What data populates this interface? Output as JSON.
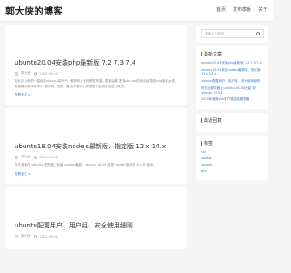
{
  "header": {
    "title": "郭大侠的博客",
    "nav": [
      "首页",
      "发布模板",
      "关于"
    ]
  },
  "posts": [
    {
      "title": "ubuntu20.04安装php最新版 7.2 7.3 7.4",
      "author": "郭大侠",
      "date": "2020-03-02",
      "excerpt": "因长久以来的一直使用ubuntu装PHP，都是网上各种教程拼凑，更新后都 发现ubuntu的系统自带的php版本太低，安装最新版本时本不 想折腾，但是一直没有成功，请根据下面的方法进行操作。",
      "more": "查看全文 >"
    },
    {
      "title": "ubuntu18.04安装nodejs最新版、指定版 12.x 14.x",
      "author": "郭大侠",
      "date": "2020-03-02",
      "excerpt": "今天准备在 ubuntu 服务器上安装 nodejs 最新，ubuntu 18.04 自带 nodejs 版本是 8.x 的 版本。",
      "more": "查看全文 >"
    },
    {
      "title": "ubuntu配置用户、用户组、安全使用细则",
      "author": "郭大侠",
      "date": "2020-03-02",
      "excerpt": "",
      "more": ""
    }
  ],
  "sidebar": {
    "search_placeholder": "请输入关键词",
    "recent_title": "最新文章",
    "recent": [
      "ubuntu20.04安装php最新版 7.2 7.3 7.4",
      "ubuntu18.04安装nodejs最新版、指定版 12.x 14.x",
      "ubuntu配置用户、用户组、安全使用细则",
      "阿里云服务器上ubuntu 18.04升级 到 ubuntu 20.04",
      "2020年使用ssh客户端连接服务器"
    ],
    "replies_title": "最近回复",
    "tags_title": "标签",
    "tags": [
      "ssh",
      "nodejs",
      "ubuntu",
      "php"
    ]
  }
}
